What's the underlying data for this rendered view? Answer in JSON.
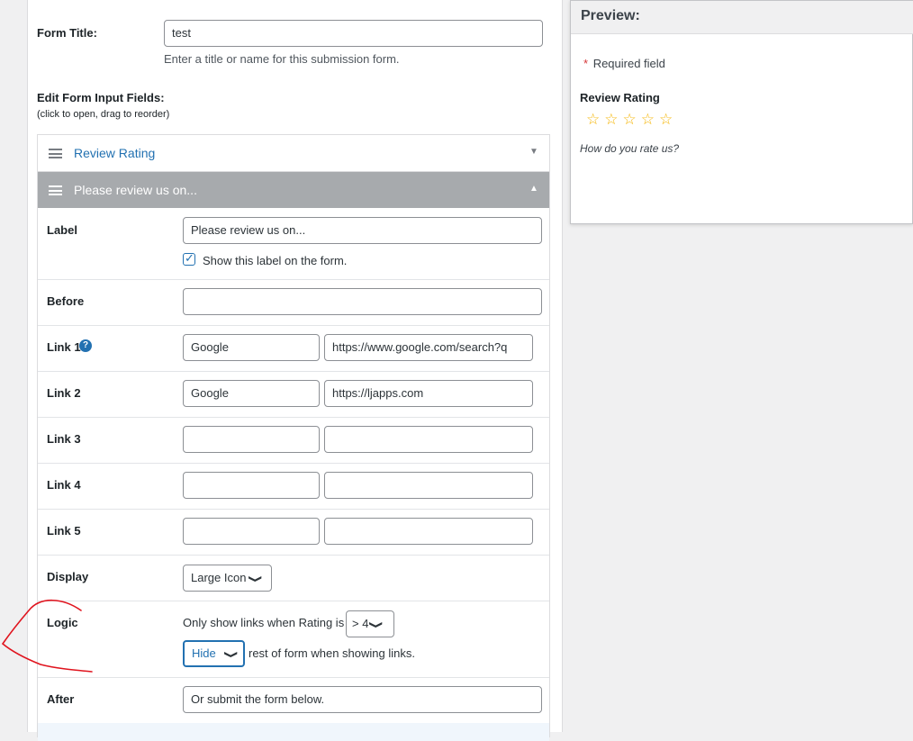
{
  "form": {
    "title_label": "Form Title:",
    "title_value": "test",
    "title_hint": "Enter a title or name for this submission form.",
    "fields_heading": "Edit Form Input Fields:",
    "fields_hint": "(click to open, drag to reorder)"
  },
  "fields": {
    "collapsed_label": "Review Rating",
    "open_label": "Please review us on..."
  },
  "editor": {
    "label_label": "Label",
    "label_value": "Please review us on...",
    "show_label_text": "Show this label on the form.",
    "show_label_checked": true,
    "before_label": "Before",
    "before_value": "",
    "links": [
      {
        "label": "Link 1",
        "name": "Google",
        "url": "https://www.google.com/search?q"
      },
      {
        "label": "Link 2",
        "name": "Google",
        "url": "https://ljapps.com"
      },
      {
        "label": "Link 3",
        "name": "",
        "url": ""
      },
      {
        "label": "Link 4",
        "name": "",
        "url": ""
      },
      {
        "label": "Link 5",
        "name": "",
        "url": ""
      }
    ],
    "help_glyph": "?",
    "display_label": "Display",
    "display_value": "Large Icon",
    "logic_label": "Logic",
    "logic_prefix": "Only show links when Rating is",
    "logic_rating": "> 4",
    "logic_action": "Hide",
    "logic_suffix": "rest of form when showing links.",
    "after_label": "After",
    "after_value": "Or submit the form below."
  },
  "preview": {
    "title": "Preview:",
    "required_mark": "*",
    "required_text": "Required field",
    "field_label": "Review Rating",
    "stars": [
      "☆",
      "☆",
      "☆",
      "☆",
      "☆"
    ],
    "question": "How do you rate us?"
  },
  "colors": {
    "link_blue": "#2271b1",
    "open_header_bg": "#a7aaad",
    "star": "#f5b400",
    "required": "#d63638",
    "annotation": "#e0141e"
  }
}
